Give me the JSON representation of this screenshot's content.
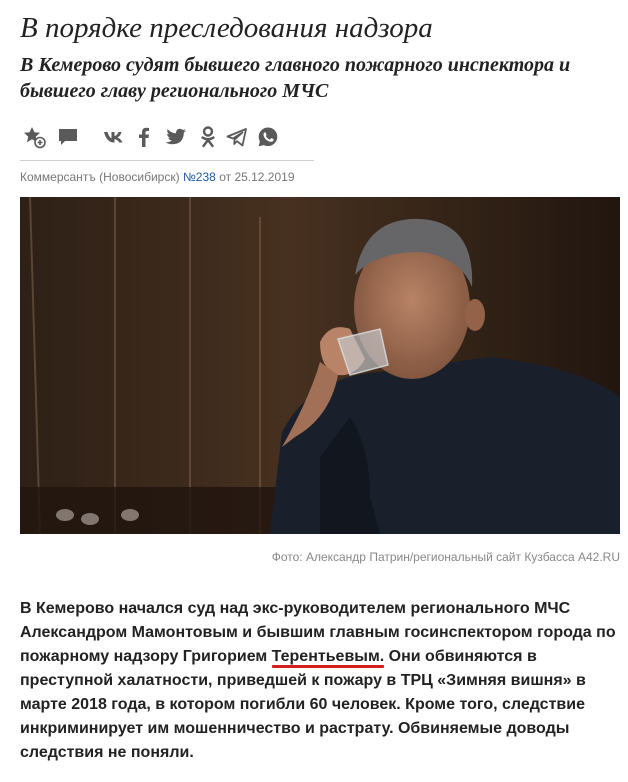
{
  "article": {
    "title": "В порядке преследования надзора",
    "subtitle": "В Кемерово судят бывшего главного пожарного инспектора и бывшего главу регионального МЧС"
  },
  "share": {
    "icons": [
      "favorite-add-icon",
      "comments-icon",
      "vk-icon",
      "facebook-icon",
      "twitter-icon",
      "odnoklassniki-icon",
      "telegram-icon",
      "whatsapp-icon"
    ]
  },
  "meta": {
    "source": "Коммерсантъ (Новосибирск)",
    "issue": "№238",
    "date_prefix": "от",
    "date": "25.12.2019"
  },
  "photo": {
    "caption": "Фото: Александр Патрин/региональный сайт Кузбасса A42.RU"
  },
  "body": {
    "before": "В Кемерово начался суд над экс-руководителем регионального МЧС Александром Мамонтовым и бывшим главным госинспектором города по пожарному надзору Григорием ",
    "highlight": "Терентьевым.",
    "after": " Они обвиняются в преступной халатности, приведшей к пожару в ТРЦ «Зимняя вишня» в марте 2018 года, в котором погибли 60 человек. Кроме того, следствие инкриминирует им мошенничество и растрату. Обвиняемые доводы следствия не поняли."
  },
  "colors": {
    "link": "#1a5aa6",
    "underline": "#d41f1f",
    "icon": "#5a5a5a"
  }
}
